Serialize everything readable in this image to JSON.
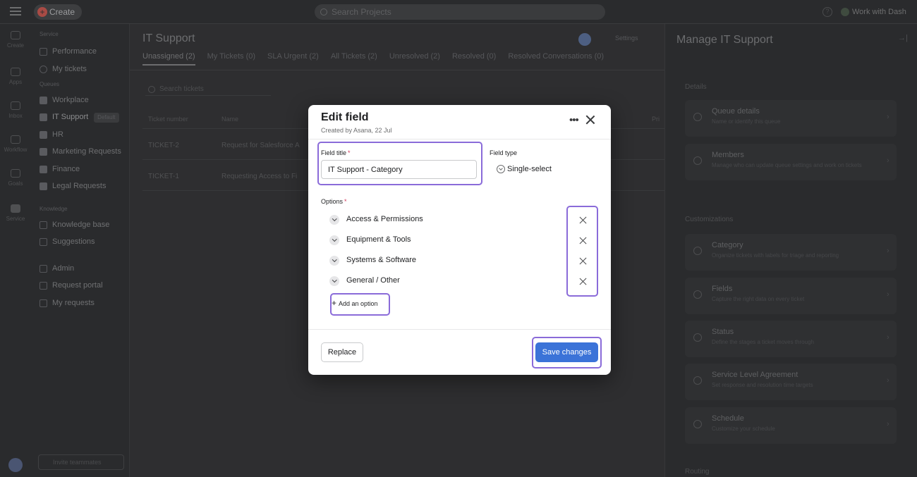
{
  "topbar": {
    "create_label": "Create",
    "search_placeholder": "Search Projects",
    "work_with_label": "Work with Dash"
  },
  "rail": {
    "items": [
      "Create",
      "Apps",
      "Inbox",
      "Workflow",
      "Goals",
      "Service"
    ]
  },
  "sidebar": {
    "section_service": "Service",
    "performance": "Performance",
    "my_tickets": "My tickets",
    "section_queues": "Queues",
    "workplace": "Workplace",
    "it_support": "IT Support",
    "default_badge": "Default",
    "hr": "HR",
    "marketing": "Marketing Requests",
    "finance": "Finance",
    "legal": "Legal Requests",
    "section_knowledge": "Knowledge",
    "knowledge_base": "Knowledge base",
    "suggestions": "Suggestions",
    "admin": "Admin",
    "request_portal": "Request portal",
    "my_requests": "My requests",
    "bottom_button": "Invite teammates"
  },
  "main": {
    "title": "IT Support",
    "settings_label": "Settings",
    "tabs": [
      {
        "label": "Unassigned (2)"
      },
      {
        "label": "My Tickets (0)"
      },
      {
        "label": "SLA Urgent (2)"
      },
      {
        "label": "All Tickets (2)"
      },
      {
        "label": "Unresolved (2)"
      },
      {
        "label": "Resolved (0)"
      },
      {
        "label": "Resolved Conversations (0)"
      }
    ],
    "search_placeholder": "Search tickets",
    "columns": [
      "Ticket number",
      "Name",
      "Pri"
    ],
    "rows": [
      {
        "number": "TICKET-2",
        "name": "Request for Salesforce A"
      },
      {
        "number": "TICKET-1",
        "name": "Requesting Access to Fi"
      }
    ]
  },
  "right_panel": {
    "title": "Manage IT Support",
    "sections": {
      "details": "Details",
      "customizations": "Customizations",
      "routing": "Routing"
    },
    "cards": [
      {
        "title": "Queue details",
        "desc": "Name or identify this queue"
      },
      {
        "title": "Members",
        "desc": "Manage who can update queue settings and work on tickets"
      },
      {
        "title": "Category",
        "desc": "Organize tickets with labels for triage and reporting"
      },
      {
        "title": "Fields",
        "desc": "Capture the right data on every ticket"
      },
      {
        "title": "Status",
        "desc": "Define the stages a ticket moves through"
      },
      {
        "title": "Service Level Agreement",
        "desc": "Set response and resolution time targets"
      },
      {
        "title": "Schedule",
        "desc": "Customize your schedule"
      }
    ]
  },
  "modal": {
    "title": "Edit field",
    "subtitle": "Created by Asana, 22 Jul",
    "more_glyph": "•••",
    "field_title_label": "Field title",
    "required_mark": "*",
    "field_title_value": "IT Support - Category",
    "field_type_label": "Field type",
    "field_type_value": "Single-select",
    "options_label": "Options",
    "options": [
      {
        "label": "Access & Permissions"
      },
      {
        "label": "Equipment & Tools"
      },
      {
        "label": "Systems & Software"
      },
      {
        "label": "General / Other"
      }
    ],
    "add_option_label": "Add an option",
    "replace_label": "Replace",
    "save_label": "Save changes"
  },
  "colors": {
    "accent": "#3b73d8",
    "highlight": "#8a6bd9",
    "required": "#d1395a"
  }
}
